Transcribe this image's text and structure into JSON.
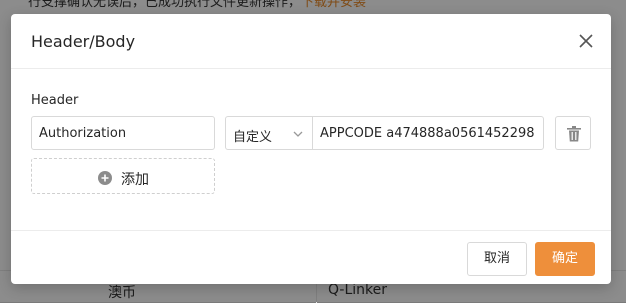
{
  "background": {
    "top_text": "行支撑确认无误后，已成功执行文件更新操作，",
    "top_link": "下载并安装",
    "row_cells": [
      "澳币",
      "Q-Linker"
    ]
  },
  "modal": {
    "title": "Header/Body",
    "close_icon": "close-icon",
    "section_label": "Header",
    "header_row": {
      "key": "Authorization",
      "type": "自定义",
      "value": "APPCODE a474888a0561452298"
    },
    "add_label": "添加",
    "footer": {
      "cancel_label": "取消",
      "ok_label": "确定"
    }
  },
  "colors": {
    "accent": "#ee8f3b",
    "border": "#d9d9d9",
    "overlay": "rgba(0,0,0,0.45)"
  }
}
